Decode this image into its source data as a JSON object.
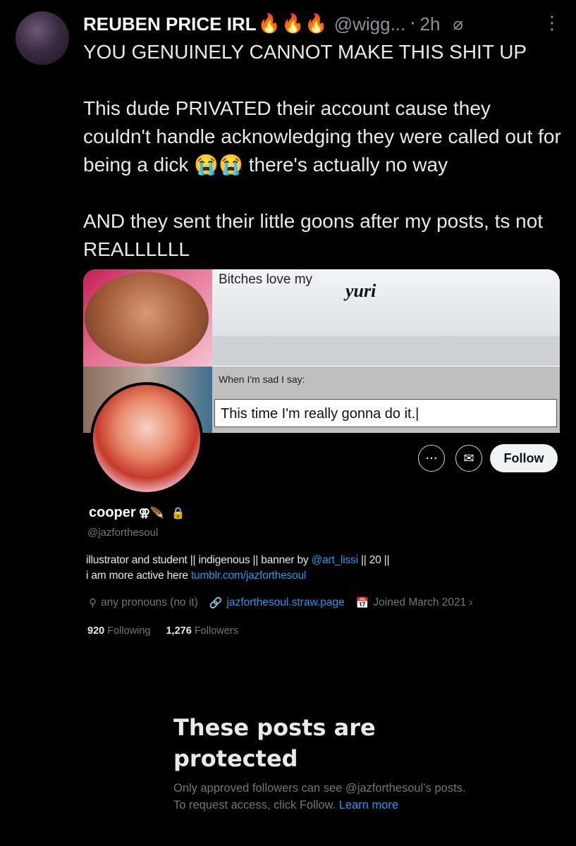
{
  "tweet": {
    "author_name": "REUBEN PRICE IRL",
    "author_emoji": "🔥🔥🔥",
    "handle": "@wigg...",
    "separator": "·",
    "time": "2h",
    "grok_icon": "⌀",
    "more_icon": "⋮",
    "lines": [
      "YOU GENUINELY CANNOT MAKE THIS SHIT UP",
      "",
      "This dude PRIVATED their account cause they couldn't handle acknowledging they were called out for being a dick 😭😭 there's actually no way",
      "",
      "AND they sent their little goons after my posts, ts not REALLLLLL"
    ]
  },
  "embed": {
    "banner": {
      "top_text": "Bitches love my",
      "yuri_text": "yuri",
      "sad_text": "When I'm sad I say:",
      "input_text": "This time I'm really gonna do it.|"
    },
    "buttons": {
      "more": "···",
      "message": "✉",
      "follow": "Follow"
    },
    "profile": {
      "name": "cooper",
      "name_emoji": "⚢🪶",
      "lock": "🔒",
      "handle": "@jazforthesoul",
      "bio_line1_a": "illustrator and student || indigenous || banner by ",
      "bio_line1_link": "@art_lissi",
      "bio_line1_b": " || 20 ||",
      "bio_line2_a": "i am more active here ",
      "bio_line2_link": "tumblr.com/jazforthesoul",
      "location_icon": "⚲",
      "location": "any pronouns (no it)",
      "link_icon": "🔗",
      "website": "jazforthesoul.straw.page",
      "calendar_icon": "📅",
      "joined": "Joined March 2021",
      "chevron": "›",
      "following_count": "920",
      "following_label": "Following",
      "followers_count": "1,276",
      "followers_label": "Followers"
    },
    "protected": {
      "title": "These posts are protected",
      "sub_a": "Only approved followers can see @jazforthesoul’s posts. To request access, click Follow. ",
      "learn_more": "Learn more"
    }
  }
}
